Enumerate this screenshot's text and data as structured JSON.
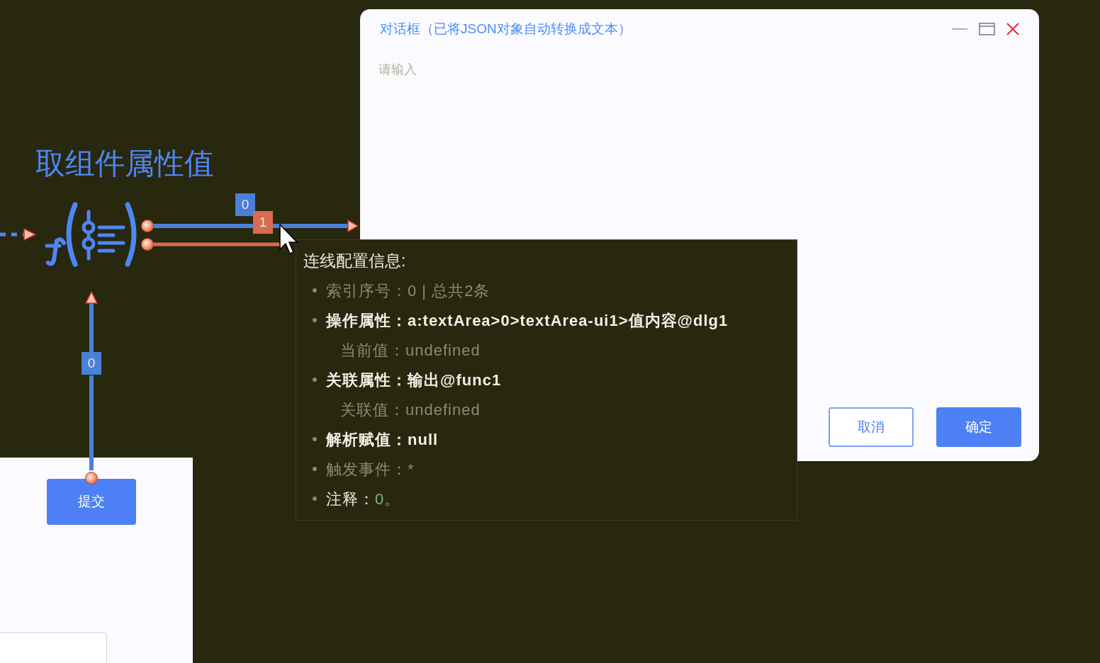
{
  "canvas": {
    "title": "取组件属性值",
    "links": [
      {
        "label": "0",
        "color": "#4a80d8"
      },
      {
        "label": "1",
        "color": "#d86c50"
      },
      {
        "label": "0",
        "color": "#4a80d8"
      }
    ],
    "panel": {
      "button": "提交"
    }
  },
  "dialog": {
    "title": "对话框（已将JSON对象自动转换成文本）",
    "placeholder": "请输入",
    "buttons": [
      {
        "label": "取消",
        "kind": "secondary"
      },
      {
        "label": "确定",
        "kind": "primary"
      }
    ]
  },
  "tooltip": {
    "title": "连线配置信息:",
    "items": [
      {
        "kind": "muted",
        "label": "索引序号：",
        "value": "0 | 总共2条"
      },
      {
        "kind": "strong",
        "label": "操作属性：",
        "value": "a:textArea>0>textArea-ui1>值内容@dlg1"
      },
      {
        "kind": "sub",
        "label": "当前值：",
        "value": "undefined"
      },
      {
        "kind": "strong",
        "label": "关联属性：",
        "value": "输出@func1"
      },
      {
        "kind": "sub",
        "label": "关联值：",
        "value": "undefined"
      },
      {
        "kind": "strong",
        "label": "解析赋值：",
        "value": "null"
      },
      {
        "kind": "muted",
        "label": "触发事件：",
        "value": "*"
      },
      {
        "kind": "note",
        "label": "注释：",
        "value": "0。"
      }
    ]
  }
}
